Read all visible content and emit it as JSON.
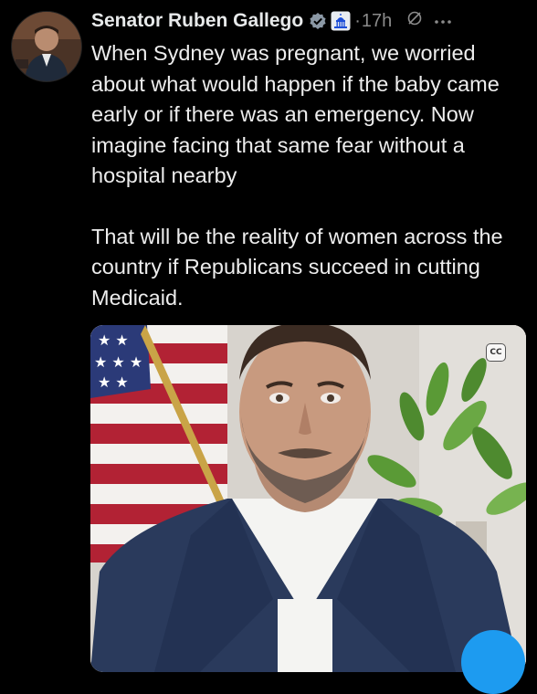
{
  "post": {
    "author_name": "Senator Ruben Gallego",
    "separator": "·",
    "time": "17h",
    "text_paragraphs": [
      "When Sydney was pregnant, we worried about what would happen if the baby came early or if there was an emergency. Now imagine facing that same fear without a hospital nearby",
      "That will be the reality of women across the country if Republicans succeed in cutting Medicaid."
    ],
    "media": {
      "type": "video",
      "captions_label": "CC"
    }
  },
  "icons": {
    "verified": "verified-checkmark-icon",
    "government": "capitol-building-icon",
    "grok": "grok-icon",
    "more": "more-options-icon"
  },
  "colors": {
    "background": "#000000",
    "text": "#e7e9ea",
    "secondary_text": "#8b8b8b",
    "accent": "#1d9bf0"
  }
}
